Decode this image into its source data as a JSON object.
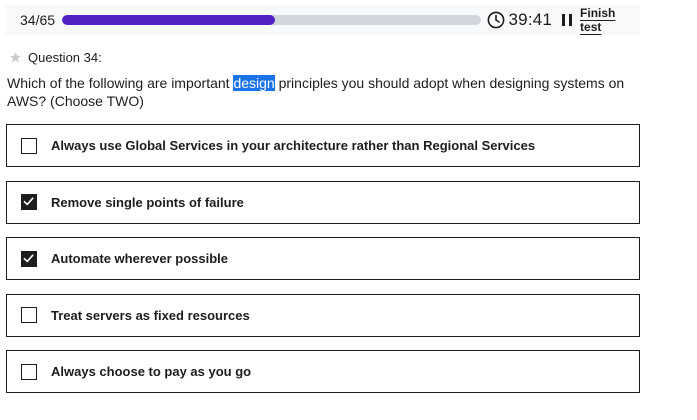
{
  "header": {
    "progress_label": "34/65",
    "progress_fraction": 0.51,
    "timer": "39:41",
    "finish_label": "Finish test",
    "colors": {
      "progress_fill": "#5022c3",
      "progress_track": "#d1d7dc"
    }
  },
  "question": {
    "number_label": "Question 34:",
    "text_before": "Which of the following are important ",
    "text_highlight": "design",
    "text_after": " principles you should adopt when designing systems on AWS? (Choose TWO)",
    "options": [
      {
        "label": "Always use Global Services in your architecture rather than Regional Services",
        "checked": false
      },
      {
        "label": "Remove single points of failure",
        "checked": true
      },
      {
        "label": "Automate wherever possible",
        "checked": true
      },
      {
        "label": "Treat servers as fixed resources",
        "checked": false
      },
      {
        "label": "Always choose to pay as you go",
        "checked": false
      }
    ]
  },
  "icons": {
    "clock": "clock-icon",
    "pause": "pause-icon",
    "star": "star-icon",
    "check": "checkmark-icon"
  }
}
